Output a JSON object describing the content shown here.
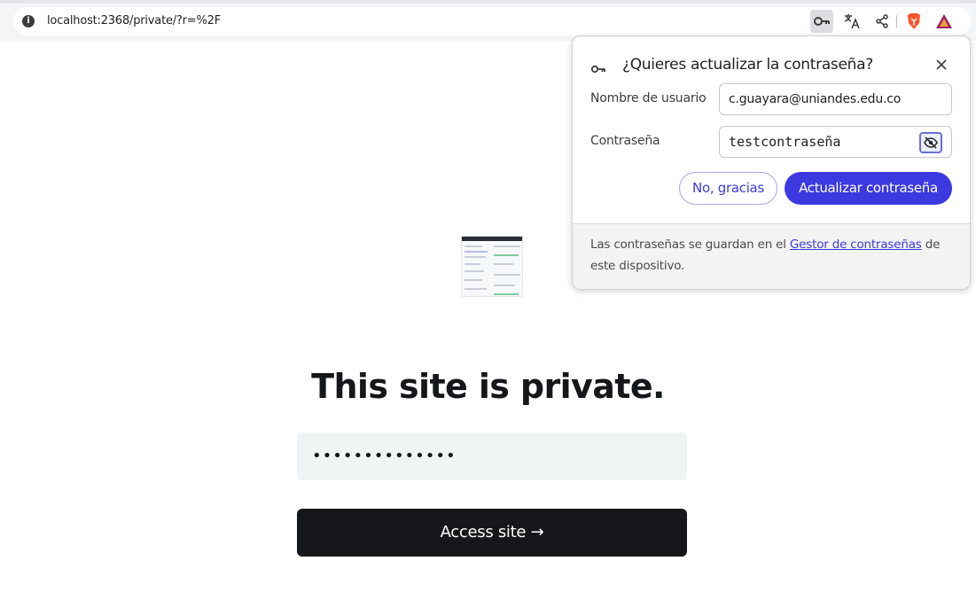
{
  "browser": {
    "url": "localhost:2368/private/?r=%2F",
    "toolbar_icons": [
      "password-key-icon",
      "translate-icon",
      "share-icon",
      "brave-shields-icon",
      "brave-rewards-icon"
    ],
    "brave_color": "#fb542b",
    "rewards_color": "#9e1f63"
  },
  "popup": {
    "title": "¿Quieres actualizar la contraseña?",
    "username_label": "Nombre de usuario",
    "username_value": "c.guayara@uniandes.edu.co",
    "password_label": "Contraseña",
    "password_value": "testcontraseña",
    "no_button": "No, gracias",
    "update_button": "Actualizar contraseña",
    "footer_prefix": "Las contraseñas se guardan en el ",
    "footer_link": "Gestor de contraseñas",
    "footer_suffix": " de este dispositivo.",
    "accent_color": "#3c39e0"
  },
  "page": {
    "title": "This site is private.",
    "password_mask": "••••••••••••••",
    "access_button": "Access site →"
  }
}
